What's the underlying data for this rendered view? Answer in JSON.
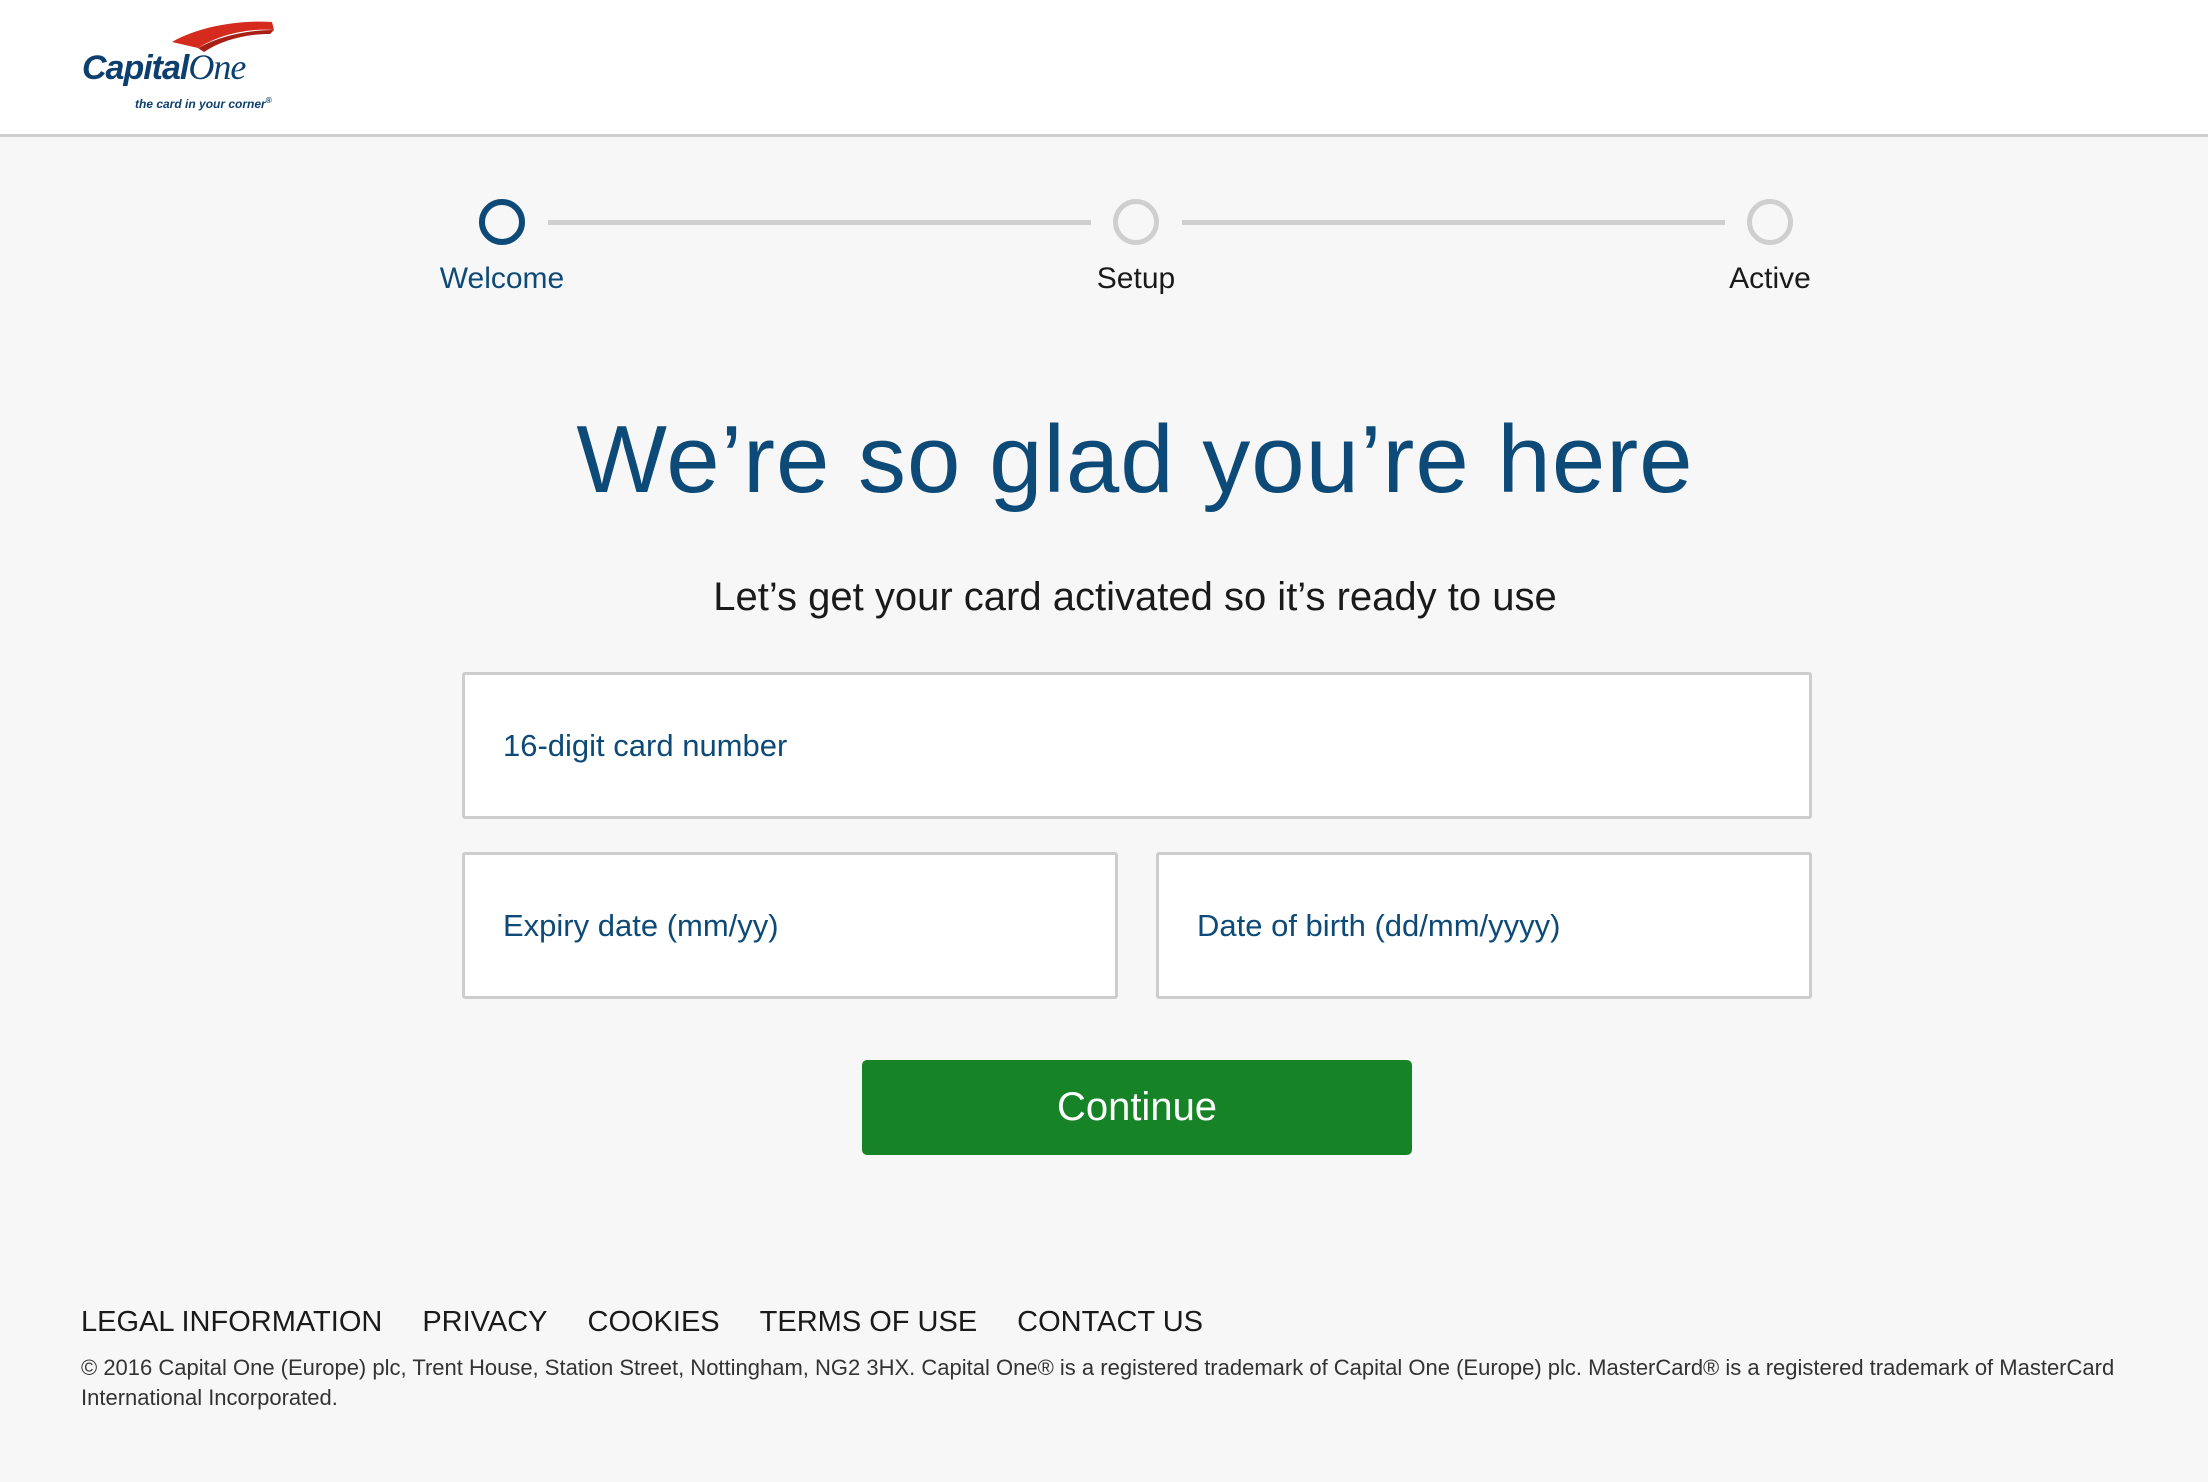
{
  "brand": {
    "name_main": "Capital",
    "name_one": "One",
    "tagline": "the card in your corner",
    "tagline_mark": "®",
    "colors": {
      "navy": "#0d4a78",
      "swoosh": "#d52b1e",
      "green": "#168426"
    }
  },
  "stepper": {
    "steps": [
      {
        "label": "Welcome",
        "state": "active"
      },
      {
        "label": "Setup",
        "state": "inactive"
      },
      {
        "label": "Active",
        "state": "inactive"
      }
    ]
  },
  "main": {
    "headline": "We’re so glad you’re here",
    "subheadline": "Let’s get your card activated so it’s ready to use",
    "card_number": {
      "value": "",
      "placeholder": "16-digit card number"
    },
    "expiry_date": {
      "value": "",
      "placeholder": "Expiry date (mm/yy)"
    },
    "date_of_birth": {
      "value": "",
      "placeholder": "Date of birth (dd/mm/yyyy)"
    },
    "continue_label": "Continue"
  },
  "footer": {
    "links": [
      "LEGAL INFORMATION",
      "PRIVACY",
      "COOKIES",
      "TERMS OF USE",
      "CONTACT US"
    ],
    "copyright": "© 2016 Capital One (Europe) plc, Trent House, Station Street, Nottingham, NG2 3HX. Capital One® is a registered trademark of Capital One (Europe) plc. MasterCard® is a registered trademark of MasterCard International Incorporated."
  }
}
